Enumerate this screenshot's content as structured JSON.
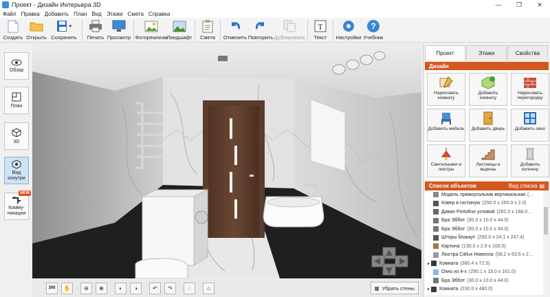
{
  "window": {
    "title": "Проект - Дизайн Интерьера 3D",
    "controls": [
      "—",
      "❐",
      "✕"
    ]
  },
  "menu": [
    "Файл",
    "Правка",
    "Добавить",
    "План",
    "Вид",
    "Этажи",
    "Смета",
    "Справка"
  ],
  "toolbar": {
    "create": "Создать",
    "open": "Открыть",
    "save": "Сохранить",
    "print": "Печать",
    "preview": "Просмотр",
    "photoreal": "Фотореализм",
    "landscape": "Ландшафт",
    "estimate": "Смета",
    "undo": "Отменить",
    "redo": "Повторить",
    "duplicate": "Дублировать",
    "text": "Текст",
    "settings": "Настройки",
    "tutorial": "Учебник"
  },
  "leftnav": {
    "overview": "Обзор",
    "plan": "План",
    "view3d": "3D",
    "inside": "Вид изнутри",
    "comms": "Комму-никации",
    "new_badge": "NEW"
  },
  "bottombar": {
    "remove_walls": "Убрать стены",
    "rotate360": "360"
  },
  "rightpanel": {
    "tabs": [
      "Проект",
      "Этажи",
      "Свойства"
    ],
    "design_header": "Дизайн",
    "design_buttons": [
      "Нарисовать комнату",
      "Добавить комнату",
      "Нарисовать перегородку",
      "Добавить мебель",
      "Добавить дверь",
      "Добавить окно",
      "Светильники и люстры",
      "Лестницы и вырезы",
      "Добавить колонну"
    ],
    "objects_header": "Список объектов",
    "view_list": "Вид списка",
    "objects": [
      {
        "name": "Модель прямоугольник вертикальная",
        "dims": "(…"
      },
      {
        "name": "Ковер в гостиную",
        "dims": "(250.0 x 250.0 x 2.0)"
      },
      {
        "name": "Диван Portofino угловой",
        "dims": "(282.0 x 168.0…"
      },
      {
        "name": "Бра Эббот",
        "dims": "(30.0 x 10.0 x 44.0)"
      },
      {
        "name": "Бра Эббот",
        "dims": "(30.0 x 10.0 x 44.0)"
      },
      {
        "name": "Шторы блэкаут",
        "dims": "(250.0 x 24.1 x 247.4)"
      },
      {
        "name": "Картина",
        "dims": "(130.0 x 2.9 x 100.0)"
      },
      {
        "name": "Люстра Citilux Новелла",
        "dims": "(58.2 x 63.5 x 2…"
      },
      {
        "name": "Комната",
        "dims": "(380.4 x 72.5)"
      },
      {
        "name": "Окно из 4-х",
        "dims": "(290.1 x 15.0 x 161.0)"
      },
      {
        "name": "Бра Эббот",
        "dims": "(30.0 x 10.0 x 44.0)"
      },
      {
        "name": "Комната",
        "dims": "(230.0 x 480.0)"
      }
    ]
  }
}
